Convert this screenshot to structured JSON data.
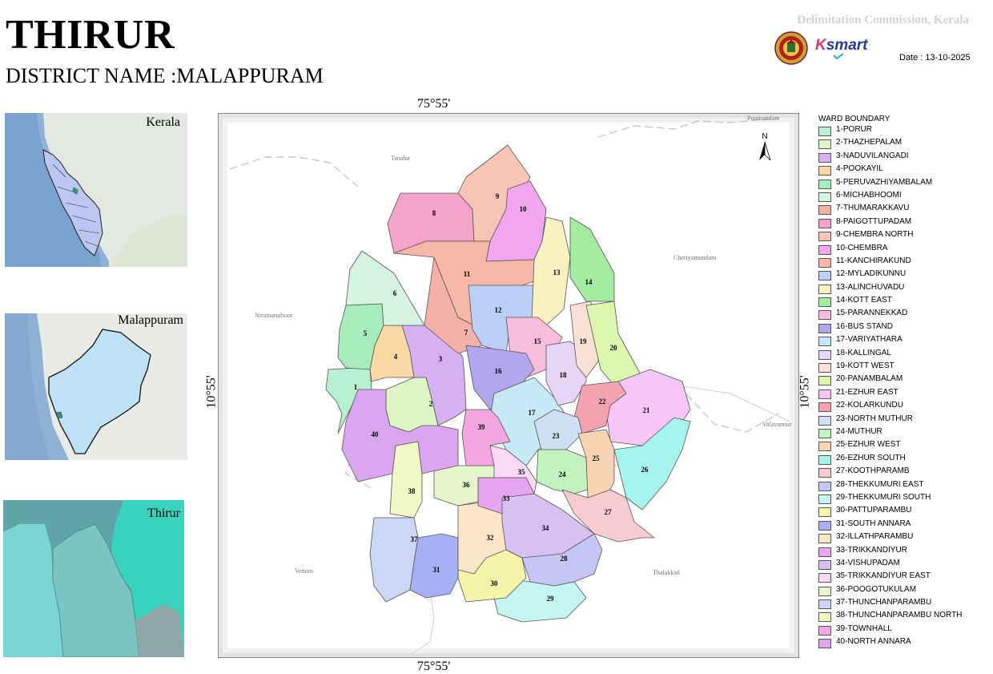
{
  "header": {
    "title": "THIRUR",
    "district": "DISTRICT NAME :MALAPPURAM",
    "commission": "Delimitation Commission, Kerala",
    "date": "Date : 13-10-2025",
    "ksmart_logo": "Ksmart",
    "seal_text": "STATE ELECTION COMMISSION KERALA"
  },
  "insets": {
    "kerala_label": "Kerala",
    "malappuram_label": "Malappuram",
    "thirur_label": "Thirur"
  },
  "map": {
    "lon_label": "75°55'",
    "lat_label": "10°55'",
    "north_label": "N",
    "places": [
      "Tanalur",
      "Cheriyamundam",
      "Niramaruthoor",
      "Valavannur",
      "Vettom",
      "Thalakkad",
      "Ponmundam"
    ]
  },
  "legend": {
    "title": "WARD BOUNDARY",
    "wards": [
      {
        "num": "1",
        "label": "1-PORUR",
        "color": "#b8f0d2"
      },
      {
        "num": "2",
        "label": "2-THAZHEPALAM",
        "color": "#dff5c6"
      },
      {
        "num": "3",
        "label": "3-NADUVILANGADI",
        "color": "#d6b0f2"
      },
      {
        "num": "4",
        "label": "4-POOKAYIL",
        "color": "#fad9a6"
      },
      {
        "num": "5",
        "label": "5-PERUVAZHIYAMBALAM",
        "color": "#a6ecbd"
      },
      {
        "num": "6",
        "label": "6-MICHABHOOMI",
        "color": "#d5f5e1"
      },
      {
        "num": "7",
        "label": "7-THUMARAKKAVU",
        "color": "#f5b0a8"
      },
      {
        "num": "8",
        "label": "8-PAIGOTTUPADAM",
        "color": "#f4a3cb"
      },
      {
        "num": "9",
        "label": "9-CHEMBRA NORTH",
        "color": "#f7c4b6"
      },
      {
        "num": "10",
        "label": "10-CHEMBRA",
        "color": "#f2a6f0"
      },
      {
        "num": "11",
        "label": "11-KANCHIRAKUND",
        "color": "#f6b8a6"
      },
      {
        "num": "12",
        "label": "12-MYLADIKUNNU",
        "color": "#b9cff5"
      },
      {
        "num": "13",
        "label": "13-ALINCHUVADU",
        "color": "#fbf0c0"
      },
      {
        "num": "14",
        "label": "14-KOTT EAST",
        "color": "#a4ec9f"
      },
      {
        "num": "15",
        "label": "15-PARANNEKKAD",
        "color": "#f8bcdc"
      },
      {
        "num": "16",
        "label": "16-BUS STAND",
        "color": "#b3a6ec"
      },
      {
        "num": "17",
        "label": "17-VARIYATHARA",
        "color": "#c6e9f6"
      },
      {
        "num": "18",
        "label": "18-KALLINGAL",
        "color": "#e6d5f6"
      },
      {
        "num": "19",
        "label": "19-KOTT WEST",
        "color": "#fbe0d6"
      },
      {
        "num": "20",
        "label": "20-PANAMBALAM",
        "color": "#dcf6ae"
      },
      {
        "num": "21",
        "label": "21-EZHUR EAST",
        "color": "#f6c6f6"
      },
      {
        "num": "22",
        "label": "22-KOLARKUNDU",
        "color": "#f4a2b0"
      },
      {
        "num": "23",
        "label": "23-NORTH MUTHUR",
        "color": "#cfe0f6"
      },
      {
        "num": "24",
        "label": "24-MUTHUR",
        "color": "#c2f3be"
      },
      {
        "num": "25",
        "label": "25-EZHUR WEST",
        "color": "#fad3b2"
      },
      {
        "num": "26",
        "label": "26-EZHUR SOUTH",
        "color": "#a6f4ee"
      },
      {
        "num": "27",
        "label": "27-KOOTHPARAMB",
        "color": "#f7cbd0"
      },
      {
        "num": "28",
        "label": "28-THEKKUMURI EAST",
        "color": "#c6c6f6"
      },
      {
        "num": "29",
        "label": "29-THEKKUMURI SOUTH",
        "color": "#c5f5f0"
      },
      {
        "num": "30",
        "label": "30-PATTUPARAMBU",
        "color": "#f5f5a9"
      },
      {
        "num": "31",
        "label": "31-SOUTH ANNARA",
        "color": "#a6b0f4"
      },
      {
        "num": "32",
        "label": "32-ILLATHPARAMBU",
        "color": "#fbe5c6"
      },
      {
        "num": "33",
        "label": "33-TRIKKANDIYUR",
        "color": "#e6a6f2"
      },
      {
        "num": "34",
        "label": "34-VISHUPADAM",
        "color": "#d8c0f2"
      },
      {
        "num": "35",
        "label": "35-TRIKKANDIYUR EAST",
        "color": "#f9d9f6"
      },
      {
        "num": "36",
        "label": "36-POOGOTUKULAM",
        "color": "#e6f6cc"
      },
      {
        "num": "37",
        "label": "37-THUNCHANPARAMBU",
        "color": "#ccd6f6"
      },
      {
        "num": "38",
        "label": "38-THUNCHANPARAMBU NORTH",
        "color": "#f1f8c6"
      },
      {
        "num": "39",
        "label": "39-TOWNHALL",
        "color": "#f3a6e0"
      },
      {
        "num": "40",
        "label": "40-NORTH ANNARA",
        "color": "#dba6f0"
      }
    ]
  }
}
